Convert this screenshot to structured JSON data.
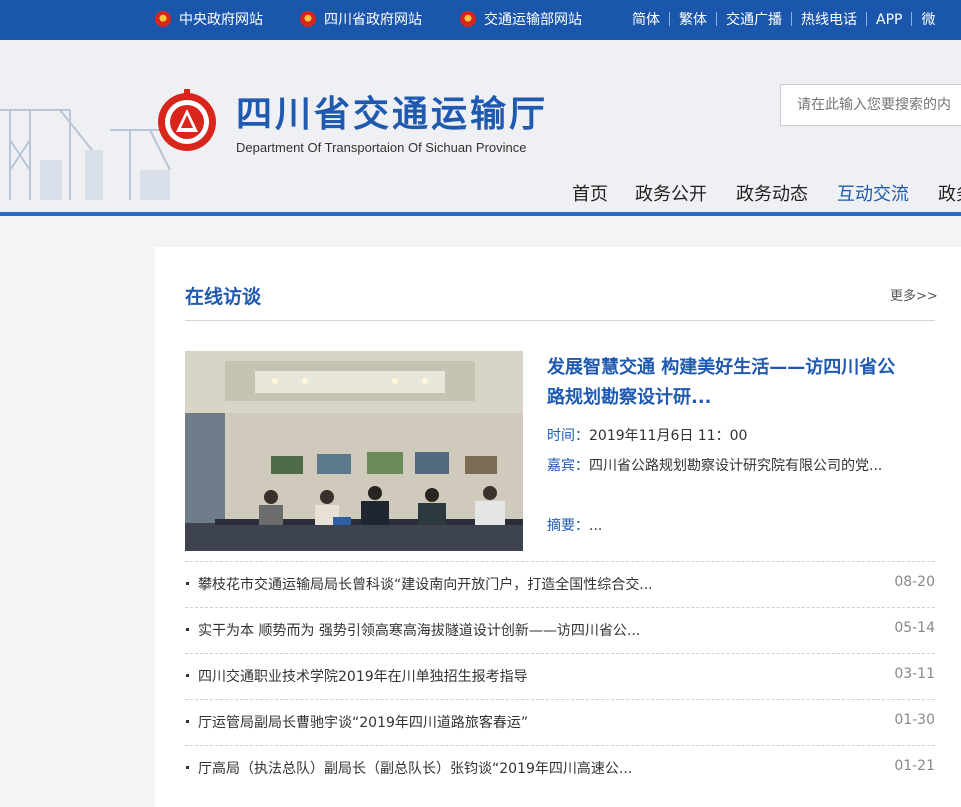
{
  "topbar": {
    "links": [
      "中央政府网站",
      "四川省政府网站",
      "交通运输部网站"
    ],
    "right": [
      "简体",
      "繁体",
      "交通广播",
      "热线电话",
      "APP",
      "微"
    ]
  },
  "header": {
    "title_cn": "四川省交通运输厅",
    "title_en": "Department Of Transportaion Of Sichuan Province",
    "search_placeholder": "请在此输入您要搜索的内",
    "nav": [
      "首页",
      "政务公开",
      "政务动态",
      "互动交流",
      "政务"
    ],
    "active_nav": "互动交流"
  },
  "section": {
    "title": "在线访谈",
    "more": "更多>>"
  },
  "featured": {
    "title": "发展智慧交通 构建美好生活——访四川省公路规划勘察设计研...",
    "time_label": "时间：",
    "time": "2019年11月6日 11：00",
    "guest_label": "嘉宾：",
    "guest": "四川省公路规划勘察设计研究院有限公司的党...",
    "summary_label": "摘要：",
    "summary": "..."
  },
  "list": [
    {
      "text": "攀枝花市交通运输局局长曾科谈“建设南向开放门户，打造全国性综合交...",
      "date": "08-20"
    },
    {
      "text": "实干为本 顺势而为 强势引领高寒高海拔隧道设计创新——访四川省公...",
      "date": "05-14"
    },
    {
      "text": "四川交通职业技术学院2019年在川单独招生报考指导",
      "date": "03-11"
    },
    {
      "text": "厅运管局副局长曹驰宇谈“2019年四川道路旅客春运”",
      "date": "01-30"
    },
    {
      "text": "厅高局（执法总队）副局长（副总队长）张钧谈“2019年四川高速公...",
      "date": "01-21"
    }
  ],
  "colors": {
    "topbar": "#1b56ad",
    "brand_blue": "#1f5ab0",
    "page_bg": "#f3f4f6"
  }
}
